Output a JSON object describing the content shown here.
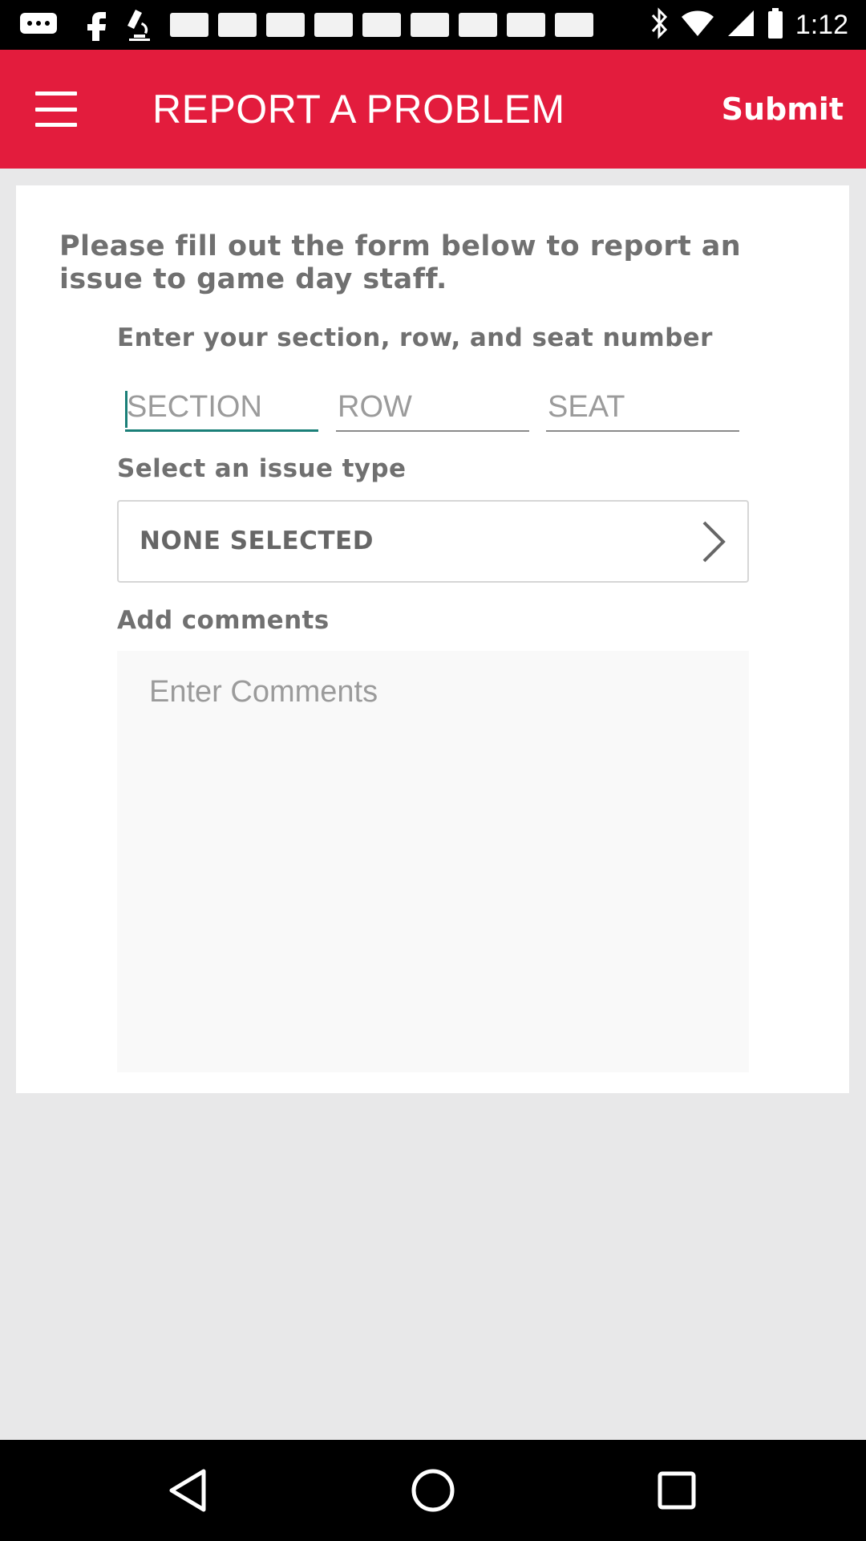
{
  "status_bar": {
    "time": "1:12",
    "notification_icons": [
      "message-icon",
      "facebook-icon",
      "microscope-icon",
      "notification-icon",
      "notification-icon",
      "notification-icon",
      "notification-icon",
      "notification-icon",
      "notification-icon",
      "notification-icon",
      "notification-icon"
    ],
    "status_icons": [
      "bluetooth-icon",
      "wifi-icon",
      "signal-icon",
      "battery-icon"
    ]
  },
  "app_bar": {
    "title": "REPORT A PROBLEM",
    "submit_label": "Submit",
    "color": "#e31c3d"
  },
  "form": {
    "intro": "Please fill out the form below to report an issue to game day staff.",
    "seat_label": "Enter your section, row, and seat number",
    "section_placeholder": "SECTION",
    "row_placeholder": "ROW",
    "seat_placeholder": "SEAT",
    "issue_label": "Select an issue type",
    "issue_value": "NONE SELECTED",
    "comments_label": "Add comments",
    "comments_placeholder": "Enter Comments",
    "focus_color": "#1a7f78"
  },
  "nav_bar": {
    "buttons": [
      "back-icon",
      "home-icon",
      "recents-icon"
    ]
  }
}
